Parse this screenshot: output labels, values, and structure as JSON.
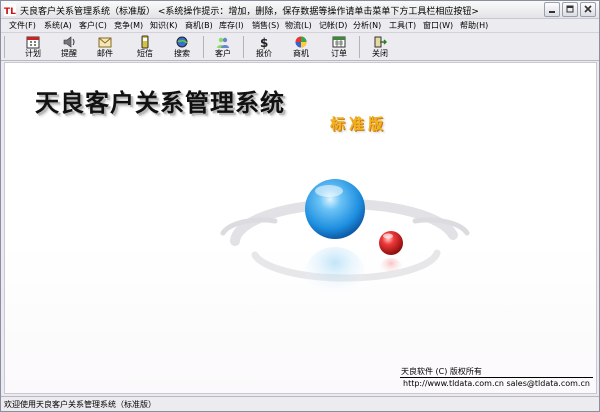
{
  "window": {
    "title": "天良客户关系管理系统（标准版）",
    "hint": "<系统操作提示：增加，删除，保存数据等操作请单击菜单下方工具栏相应按钮>"
  },
  "menu": [
    {
      "label": "文件(F)"
    },
    {
      "label": "系统(A)"
    },
    {
      "label": "客户(C)"
    },
    {
      "label": "竞争(M)"
    },
    {
      "label": "知识(K)"
    },
    {
      "label": "商机(B)"
    },
    {
      "label": "库存(I)"
    },
    {
      "label": "销售(S)"
    },
    {
      "label": "物流(L)"
    },
    {
      "label": "记帐(D)"
    },
    {
      "label": "分析(N)"
    },
    {
      "label": "工具(T)"
    },
    {
      "label": "窗口(W)"
    },
    {
      "label": "帮助(H)"
    }
  ],
  "toolbar": [
    {
      "label": "计划",
      "icon": "calendar-icon"
    },
    {
      "label": "提醒",
      "icon": "speaker-icon"
    },
    {
      "label": "邮件",
      "icon": "envelope-icon"
    },
    {
      "label": "短信",
      "icon": "mobile-phone-icon"
    },
    {
      "label": "搜索",
      "icon": "globe-search-icon"
    },
    {
      "label": "客户",
      "icon": "people-icon"
    },
    {
      "label": "报价",
      "icon": "dollar-icon"
    },
    {
      "label": "商机",
      "icon": "color-ball-icon"
    },
    {
      "label": "订单",
      "icon": "order-sheet-icon"
    },
    {
      "label": "关闭",
      "icon": "exit-icon"
    }
  ],
  "main": {
    "title": "天良客户关系管理系统",
    "edition": "标准版",
    "copyright": "天良软件 (C) 版权所有",
    "contact": "http://www.tldata.com.cn  sales@tldata.com.cn"
  },
  "status": {
    "text": "欢迎使用天良客户关系管理系统（标准版）"
  },
  "colors": {
    "edition": "#f6b21c",
    "big_sphere": "#1e8fe0",
    "small_sphere": "#d81a1a"
  }
}
